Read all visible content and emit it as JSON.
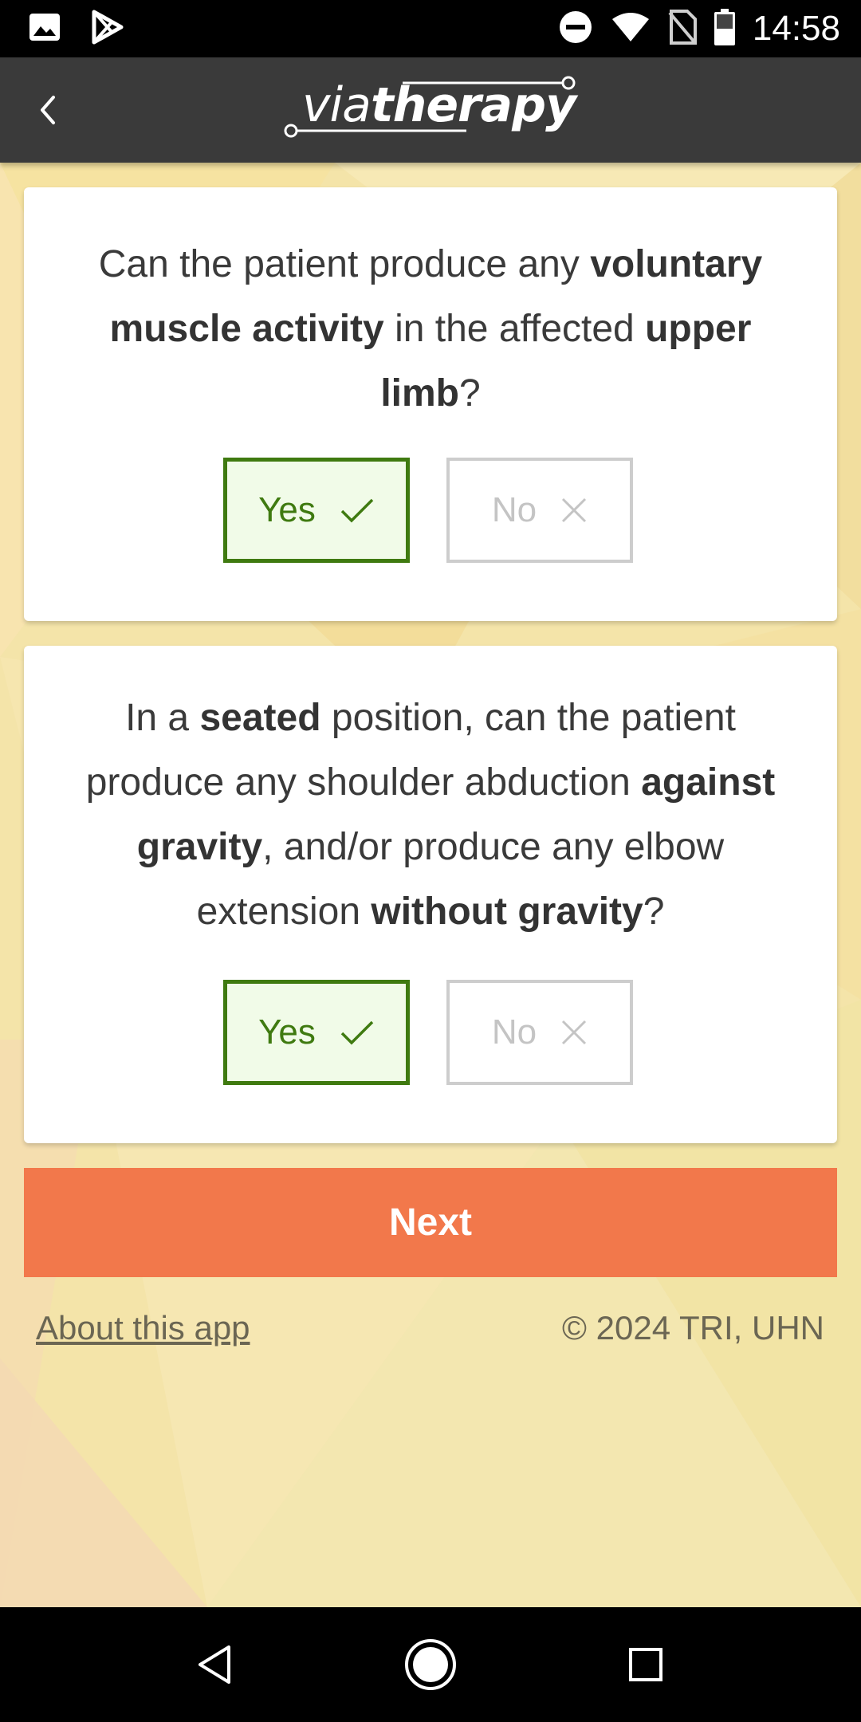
{
  "status_bar": {
    "time": "14:58",
    "left_icons": [
      "image-icon",
      "play-store-icon"
    ],
    "right_icons": [
      "do-not-disturb-icon",
      "wifi-icon",
      "no-sim-icon",
      "battery-icon"
    ]
  },
  "app_bar": {
    "logo_prefix": "via",
    "logo_suffix": "therapy",
    "back_icon": "chevron-left-icon"
  },
  "questions": [
    {
      "parts": [
        {
          "text": "Can the patient produce any ",
          "bold": false
        },
        {
          "text": "voluntary muscle activity",
          "bold": true
        },
        {
          "text": " in the affected ",
          "bold": false
        },
        {
          "text": "upper limb",
          "bold": true
        },
        {
          "text": "?",
          "bold": false
        }
      ],
      "yes_label": "Yes",
      "no_label": "No",
      "selected": "yes"
    },
    {
      "parts": [
        {
          "text": "In a ",
          "bold": false
        },
        {
          "text": "seated",
          "bold": true
        },
        {
          "text": " position, can the patient produce any shoulder abduction ",
          "bold": false
        },
        {
          "text": "against gravity",
          "bold": true
        },
        {
          "text": ", and/or produce any elbow extension ",
          "bold": false
        },
        {
          "text": "without gravity",
          "bold": true
        },
        {
          "text": "?",
          "bold": false
        }
      ],
      "yes_label": "Yes",
      "no_label": "No",
      "selected": "yes"
    }
  ],
  "next_label": "Next",
  "footer": {
    "about_label": "About this app",
    "copyright": "© 2024 TRI, UHN"
  },
  "colors": {
    "app_bar": "#3a3a3a",
    "yes_selected": "#3f7a10",
    "yes_selected_bg": "#f1fbe8",
    "no_border": "#cdcdcd",
    "next_button": "#f2784b",
    "background": "#f3e3a6"
  },
  "nav_bar": {
    "icons": [
      "nav-back-icon",
      "nav-home-icon",
      "nav-recents-icon"
    ]
  }
}
